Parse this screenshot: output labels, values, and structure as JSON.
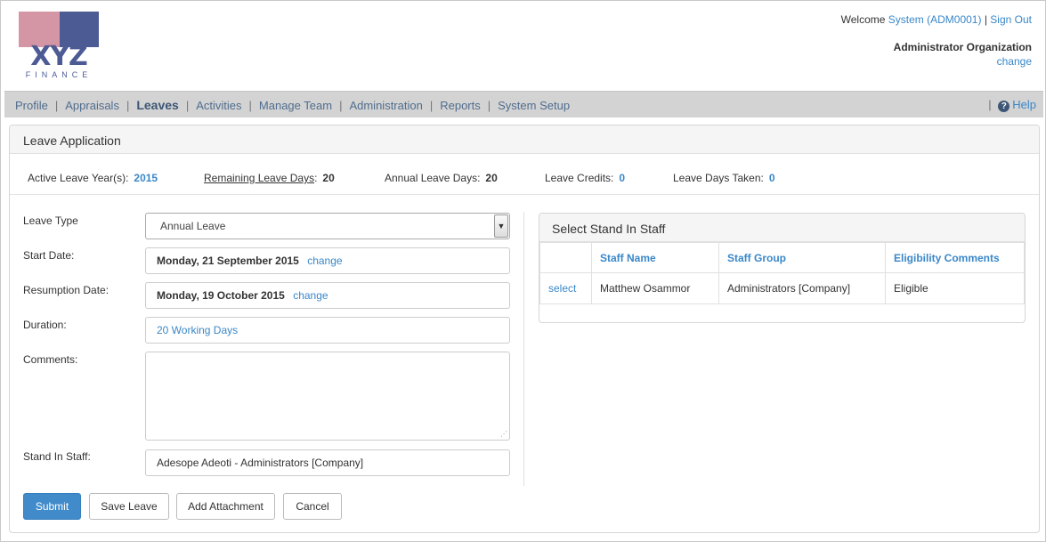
{
  "logo": {
    "mark": "XYZ",
    "sub": "FINANCE"
  },
  "user": {
    "welcome": "Welcome",
    "name": "System (ADM0001)",
    "pipe": "|",
    "sign_out": "Sign Out",
    "organization": "Administrator Organization",
    "org_change": "change"
  },
  "nav": {
    "items": [
      "Profile",
      "Appraisals",
      "Leaves",
      "Activities",
      "Manage Team",
      "Administration",
      "Reports",
      "System Setup"
    ],
    "active": "Leaves",
    "separator": "|",
    "help": "Help"
  },
  "panel": {
    "title": "Leave Application"
  },
  "stats": {
    "active_year_label": "Active Leave Year(s):",
    "active_year_value": "2015",
    "remaining_label": "Remaining Leave Days",
    "remaining_colon": ":",
    "remaining_value": "20",
    "annual_label": "Annual Leave Days:",
    "annual_value": "20",
    "credits_label": "Leave Credits:",
    "credits_value": "0",
    "taken_label": "Leave Days Taken:",
    "taken_value": "0"
  },
  "form": {
    "leave_type_label": "Leave Type",
    "leave_type_value": "Annual Leave",
    "start_label": "Start Date:",
    "start_value": "Monday, 21 September 2015",
    "start_change": "change",
    "resume_label": "Resumption Date:",
    "resume_value": "Monday, 19 October 2015",
    "resume_change": "change",
    "duration_label": "Duration:",
    "duration_value": "20 Working Days",
    "comments_label": "Comments:",
    "comments_value": "",
    "standin_label": "Stand In Staff:",
    "standin_value": "Adesope Adeoti - Administrators [Company]"
  },
  "standin_panel": {
    "title": "Select Stand In Staff",
    "columns": [
      "",
      "Staff Name",
      "Staff Group",
      "Eligibility Comments"
    ],
    "rows": [
      {
        "action": "select",
        "name": "Matthew Osammor",
        "group": "Administrators [Company]",
        "comment": "Eligible"
      }
    ]
  },
  "buttons": {
    "submit": "Submit",
    "save": "Save Leave",
    "attach": "Add Attachment",
    "cancel": "Cancel"
  },
  "colors": {
    "primary": "#428bca",
    "link": "#3a87c8",
    "nav_bg": "#d3d3d3"
  },
  "icons": {
    "help": "question-circle-icon",
    "dropdown": "chevron-down-icon",
    "resize": "resize-grip-icon"
  }
}
